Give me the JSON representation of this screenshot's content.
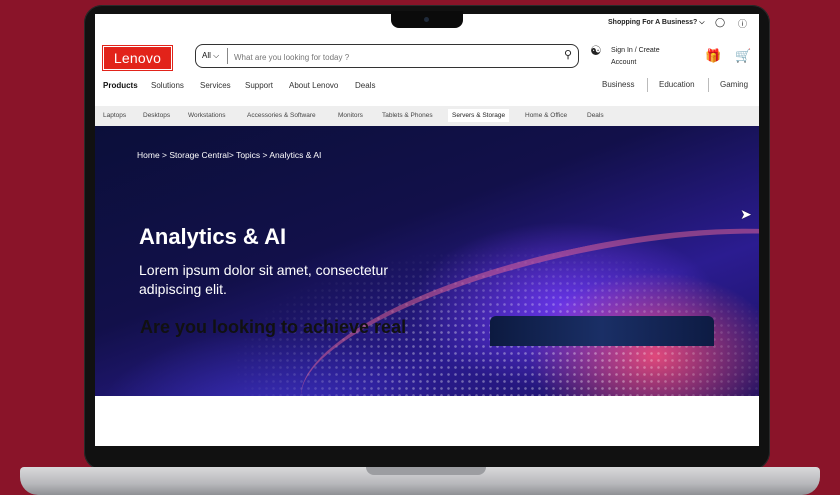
{
  "utility": {
    "business_label": "Shopping For A Business? ⌵",
    "globe_icon": "globe-icon",
    "help_icon": "help-icon"
  },
  "header": {
    "logo": "Lenovo",
    "search": {
      "category": "All ⌵",
      "placeholder": "What are you looking for today ?"
    },
    "signin": "Sign In / Create Account"
  },
  "main_nav": {
    "items": [
      "Products",
      "Solutions",
      "Services",
      "Support",
      "About Lenovo",
      "Deals"
    ],
    "right_items": [
      "Business",
      "Education",
      "Gaming"
    ]
  },
  "sub_nav": {
    "items": [
      "Laptops",
      "Desktops",
      "Workstations",
      "Accessories & Software",
      "Monitors",
      "Tablets & Phones",
      "Servers & Storage",
      "Home & Office",
      "Deals"
    ],
    "active": "Servers & Storage"
  },
  "hero": {
    "breadcrumb": "Home > Storage Central> Topics > Analytics & AI",
    "title": "Analytics & AI",
    "subtitle": "Lorem ipsum dolor sit amet, consectetur adipiscing elit."
  },
  "section": {
    "heading": "Are you looking to achieve real"
  },
  "colors": {
    "background": "#8a1429",
    "brand_red": "#e2231a"
  }
}
